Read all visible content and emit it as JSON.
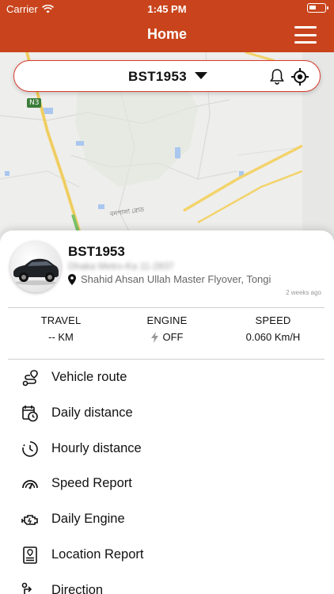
{
  "status_bar": {
    "carrier": "Carrier",
    "time": "1:45 PM"
  },
  "header": {
    "title": "Home",
    "menu_icon": "hamburger-menu-icon"
  },
  "map": {
    "road_label": "N3",
    "place_label": "বনপালা রোড"
  },
  "vehicle_selector": {
    "selected": "BST1953",
    "icons": [
      "bell-icon",
      "locate-icon"
    ]
  },
  "vehicle": {
    "name": "BST1953",
    "subtitle": "Dhaka Metro-Ka 11-2837",
    "address": "Shahid Ahsan Ullah Master Flyover, Tongi",
    "updated": "2 weeks ago"
  },
  "stats": [
    {
      "label": "TRAVEL",
      "value": "-- KM"
    },
    {
      "label": "ENGINE",
      "value": "OFF"
    },
    {
      "label": "SPEED",
      "value": "0.060 Km/H"
    }
  ],
  "menu": [
    {
      "label": "Vehicle route",
      "icon": "route-icon"
    },
    {
      "label": "Daily distance",
      "icon": "calendar-clock-icon"
    },
    {
      "label": "Hourly distance",
      "icon": "clock-icon"
    },
    {
      "label": "Speed Report",
      "icon": "speedometer-icon"
    },
    {
      "label": "Daily Engine",
      "icon": "engine-icon"
    },
    {
      "label": "Location Report",
      "icon": "report-icon"
    },
    {
      "label": "Direction",
      "icon": "direction-icon"
    }
  ],
  "colors": {
    "brand": "#c9441c",
    "accent_border": "#d93c2d"
  }
}
